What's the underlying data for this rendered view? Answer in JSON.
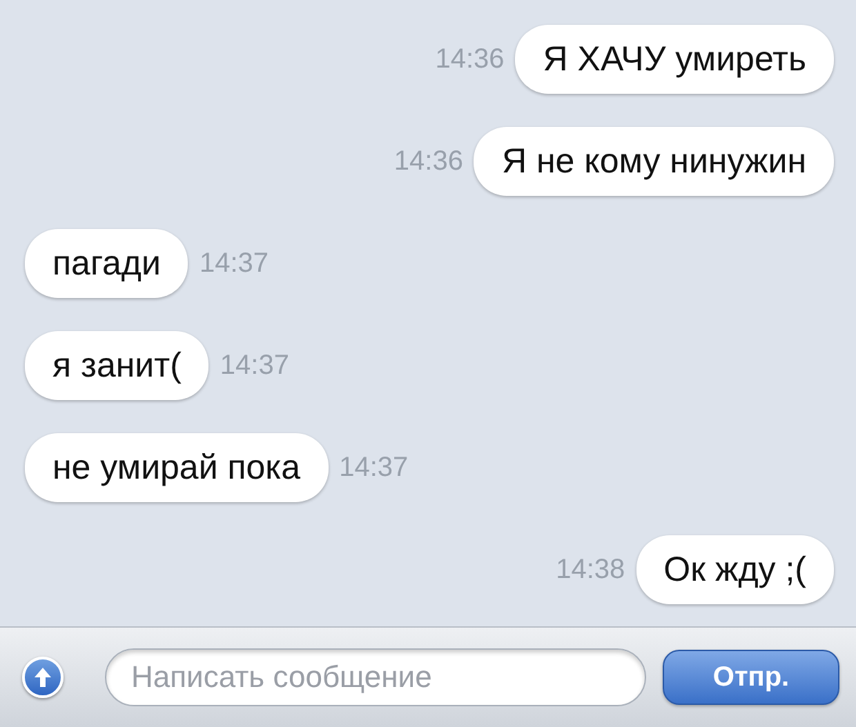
{
  "messages": [
    {
      "kind": "outgoing",
      "time": "14:36",
      "text": "Я ХАЧУ умиреть"
    },
    {
      "kind": "outgoing",
      "time": "14:36",
      "text": "Я не кому нинужин"
    },
    {
      "kind": "incoming",
      "time": "14:37",
      "text": "пагади"
    },
    {
      "kind": "incoming",
      "time": "14:37",
      "text": "я занит("
    },
    {
      "kind": "incoming",
      "time": "14:37",
      "text": "не умирай пока"
    },
    {
      "kind": "outgoing",
      "time": "14:38",
      "text": "Ок жду ;("
    }
  ],
  "composer": {
    "placeholder": "Написать сообщение",
    "send_label": "Отпр."
  }
}
